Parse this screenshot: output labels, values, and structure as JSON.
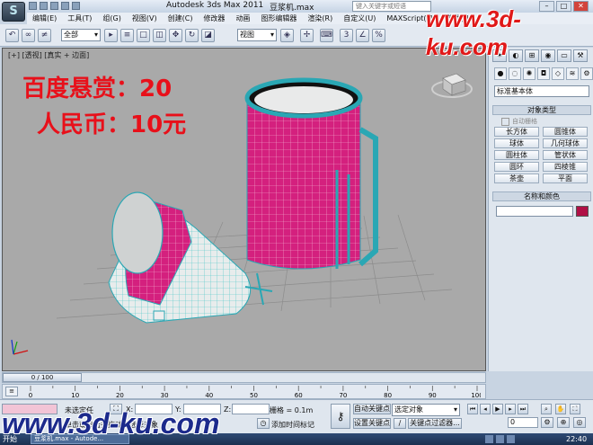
{
  "titlebar": {
    "app_title": "Autodesk 3ds Max  2011",
    "file_title": "豆浆机.max",
    "search_placeholder": "键入关键字或短语"
  },
  "menu": [
    "编辑(E)",
    "工具(T)",
    "组(G)",
    "视图(V)",
    "创建(C)",
    "修改器",
    "动画",
    "图形编辑器",
    "渲染(R)",
    "自定义(U)",
    "MAXScript(M)",
    "帮助(H)"
  ],
  "toolbar": {
    "selection_filter": "全部",
    "ref_coord": "视图"
  },
  "viewport": {
    "label": "[+] [透视] [真实 + 边面]",
    "promo_line1": "百度悬赏：20",
    "promo_line2": "人民币：10元"
  },
  "watermarks": {
    "top": "www.3d-ku.com",
    "bottom": "www.3d-ku.com"
  },
  "command_panel": {
    "category": "标准基本体",
    "object_type_title": "对象类型",
    "autogrid_label": "自动栅格",
    "object_buttons": [
      "长方体",
      "圆锥体",
      "球体",
      "几何球体",
      "圆柱体",
      "管状体",
      "圆环",
      "四棱锥",
      "茶壶",
      "平面"
    ],
    "name_color_title": "名称和颜色",
    "object_color": "#b01046"
  },
  "timeline": {
    "frame_display": "0 / 100",
    "ruler_ticks": [
      "0",
      "10",
      "20",
      "30",
      "40",
      "50",
      "60",
      "70",
      "80",
      "90",
      "100"
    ]
  },
  "status": {
    "selection_status": "未选定任",
    "x_label": "X:",
    "y_label": "Y:",
    "z_label": "Z:",
    "grid_label": "栅格 = 0.1m",
    "add_time_tag": "添加时间标记",
    "auto_key": "自动关键点",
    "key_set_target": "选定对象",
    "set_key": "设置关键点",
    "key_filters": "关键点过滤器...",
    "frame_value": "0",
    "prompt_text": "单击或单击并拖动以选择对象"
  },
  "taskbar": {
    "start": "开始",
    "task_item": "豆浆机.max - Autode...",
    "clock": "22:40"
  }
}
